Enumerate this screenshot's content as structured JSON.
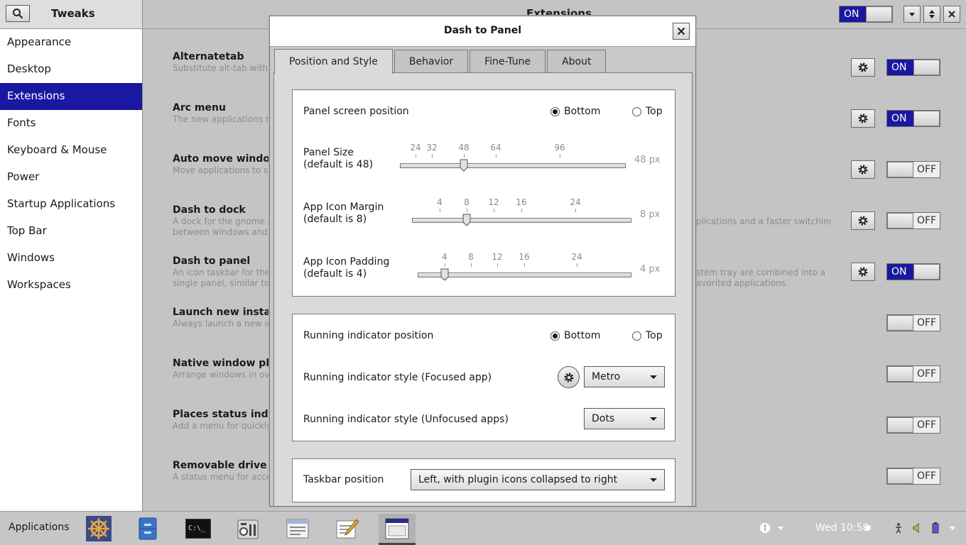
{
  "sidebar": {
    "title": "Tweaks",
    "items": [
      {
        "label": "Appearance"
      },
      {
        "label": "Desktop"
      },
      {
        "label": "Extensions"
      },
      {
        "label": "Fonts"
      },
      {
        "label": "Keyboard & Mouse"
      },
      {
        "label": "Power"
      },
      {
        "label": "Startup Applications"
      },
      {
        "label": "Top Bar"
      },
      {
        "label": "Windows"
      },
      {
        "label": "Workspaces"
      }
    ],
    "active_index": 2
  },
  "main": {
    "title": "Extensions",
    "master_toggle": "ON",
    "extensions": [
      {
        "name": "Alternatetab",
        "desc": "Substitute alt-tab with a",
        "desc2": "",
        "has_settings": true,
        "state": "ON"
      },
      {
        "name": "Arc menu",
        "desc": "The new applications me",
        "desc2": "",
        "has_settings": true,
        "state": "ON"
      },
      {
        "name": "Auto move window",
        "desc": "Move applications to spe",
        "desc2": "",
        "has_settings": true,
        "state": "OFF"
      },
      {
        "name": "Dash to dock",
        "desc": "A dock for the gnome sh",
        "desc2": "between windows and d",
        "right_desc": "plications and a faster switching",
        "has_settings": true,
        "state": "OFF"
      },
      {
        "name": "Dash to panel",
        "desc": "An icon taskbar for the g",
        "desc2": "single panel, similar to th",
        "right_desc": "stem tray are combined into a",
        "right_desc2": "avorited applications.",
        "has_settings": true,
        "state": "ON"
      },
      {
        "name": "Launch new instanc",
        "desc": "Always launch a new inst",
        "desc2": "",
        "has_settings": false,
        "state": "OFF"
      },
      {
        "name": "Native window plac",
        "desc": "Arrange windows in over",
        "desc2": "",
        "has_settings": false,
        "state": "OFF"
      },
      {
        "name": "Places status indica",
        "desc": "Add a menu for quickly n",
        "desc2": "",
        "has_settings": false,
        "state": "OFF"
      },
      {
        "name": "Removable drive m",
        "desc": "A status menu for access",
        "desc2": "",
        "has_settings": false,
        "state": "OFF"
      }
    ]
  },
  "dialog": {
    "title": "Dash to Panel",
    "tabs": [
      "Position and Style",
      "Behavior",
      "Fine-Tune",
      "About"
    ],
    "active_tab": 0,
    "panel_position": {
      "label": "Panel screen position",
      "options": [
        "Bottom",
        "Top"
      ],
      "selected": "Bottom"
    },
    "sliders": [
      {
        "label1": "Panel Size",
        "label2": "(default is 48)",
        "ticks": [
          "24",
          "32",
          "48",
          "64",
          "96"
        ],
        "value_text": "48 px",
        "value": 48
      },
      {
        "label1": "App Icon Margin",
        "label2": "(default is 8)",
        "ticks": [
          "4",
          "8",
          "12",
          "16",
          "24"
        ],
        "value_text": "8 px",
        "value": 8
      },
      {
        "label1": "App Icon Padding",
        "label2": "(default is 4)",
        "ticks": [
          "4",
          "8",
          "12",
          "16",
          "24"
        ],
        "value_text": "4 px",
        "value": 4
      }
    ],
    "running_position": {
      "label": "Running indicator position",
      "options": [
        "Bottom",
        "Top"
      ],
      "selected": "Bottom"
    },
    "focused_style": {
      "label": "Running indicator style (Focused app)",
      "value": "Metro"
    },
    "unfocused_style": {
      "label": "Running indicator style (Unfocused apps)",
      "value": "Dots"
    },
    "taskbar_position": {
      "label": "Taskbar position",
      "value": "Left, with plugin icons collapsed to right"
    }
  },
  "taskbar": {
    "apps_label": "Applications",
    "apps": [
      "helm-icon",
      "file-manager-icon",
      "terminal-icon",
      "settings-panel-icon",
      "browser-window-icon",
      "text-editor-icon",
      "dialog-window-icon"
    ],
    "active_app_index": 6,
    "clock": "Wed 10:58",
    "terminal_text": "C:\\_"
  },
  "colors": {
    "accent": "#1a18a0",
    "background": "#c4c4c4"
  }
}
